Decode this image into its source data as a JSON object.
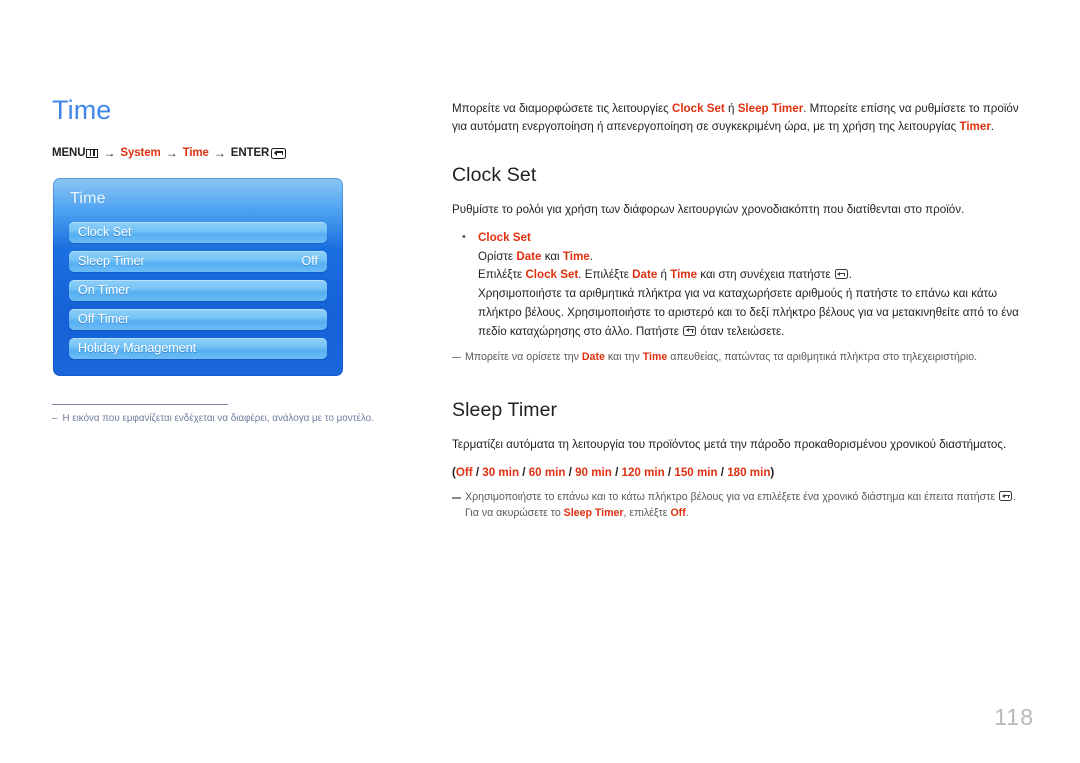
{
  "document": {
    "page_number": "118",
    "title": "Time"
  },
  "colors": {
    "title_blue": "#4285e8",
    "accent_red": "#e03010",
    "osd_panel_blue": "#1561d8",
    "osd_item_blue": "#74c3f6",
    "footnote_gray_blue": "#6f7b9e",
    "page_number_gray": "#b9b9b9"
  },
  "breadcrumb": {
    "menu_label": "MENU",
    "menu_icon": "menu-grid-icon",
    "arrow": "→",
    "step_system": "System",
    "step_time": "Time",
    "enter_label": "ENTER",
    "enter_icon": "enter-key-icon"
  },
  "osd": {
    "title": "Time",
    "items": [
      {
        "label": "Clock Set",
        "value": ""
      },
      {
        "label": "Sleep Timer",
        "value": "Off"
      },
      {
        "label": "On Timer",
        "value": ""
      },
      {
        "label": "Off Timer",
        "value": ""
      },
      {
        "label": "Holiday Management",
        "value": ""
      }
    ]
  },
  "left_note": {
    "dash": "–",
    "text": "Η εικόνα που εμφανίζεται ενδέχεται να διαφέρει, ανάλογα με το μοντέλο."
  },
  "intro": {
    "part1": "Μπορείτε να διαμορφώσετε τις λειτουργίες ",
    "kw1": "Clock Set",
    "part2": " ή ",
    "kw2": "Sleep Timer",
    "part3": ". Μπορείτε επίσης να ρυθμίσετε το προϊόν για αυτόματη ενεργοποίηση ή απενεργοποίηση σε συγκεκριμένη ώρα, με τη χρήση της λειτουργίας ",
    "kw3": "Timer",
    "part4": "."
  },
  "clock_set": {
    "heading": "Clock Set",
    "lead": "Ρυθμίστε το ρολόι για χρήση των διάφορων λειτουργιών χρονοδιακόπτη που διατίθενται στο προϊόν.",
    "bullet_dot": "•",
    "bullet_title": "Clock Set",
    "line1_a": "Ορίστε ",
    "line1_kw1": "Date",
    "line1_b": " και ",
    "line1_kw2": "Time",
    "line1_c": ".",
    "line2_a": "Επιλέξτε ",
    "line2_kw1": "Clock Set",
    "line2_b": ". Επιλέξτε ",
    "line2_kw2": "Date",
    "line2_c": " ή ",
    "line2_kw3": "Time",
    "line2_d": " και στη συνέχεια πατήστε ",
    "line2_e": ".",
    "line3_a": "Χρησιμοποιήστε τα αριθμητικά πλήκτρα για να καταχωρήσετε αριθμούς ή πατήστε το επάνω και κάτω πλήκτρο βέλους. Χρησιμοποιήστε το αριστερό και το δεξί πλήκτρο βέλους για να μετακινηθείτε από το ένα πεδίο καταχώρησης στο άλλο. Πατήστε ",
    "line3_b": " όταν τελειώσετε.",
    "note_a": "Μπορείτε να ορίσετε την ",
    "note_kw1": "Date",
    "note_b": " και την ",
    "note_kw2": "Time",
    "note_c": " απευθείας, πατώντας τα αριθμητικά πλήκτρα στο τηλεχειριστήριο."
  },
  "sleep_timer": {
    "heading": "Sleep Timer",
    "lead": "Τερματίζει αυτόματα τη λειτουργία του προϊόντος μετά την πάροδο προκαθορισμένου χρονικού διαστήματος.",
    "options_open": "(",
    "options": [
      "Off",
      "30 min",
      "60 min",
      "90 min",
      "120 min",
      "150 min",
      "180 min"
    ],
    "options_sep": " / ",
    "options_close": ")",
    "note_a": "Χρησιμοποιήστε το επάνω και το κάτω πλήκτρο βέλους για να επιλέξετε ένα χρονικό διάστημα και έπειτα πατήστε ",
    "note_b": ". Για να ακυρώσετε το ",
    "note_kw1": "Sleep Timer",
    "note_c": ", επιλέξτε ",
    "note_kw2": "Off",
    "note_d": "."
  }
}
